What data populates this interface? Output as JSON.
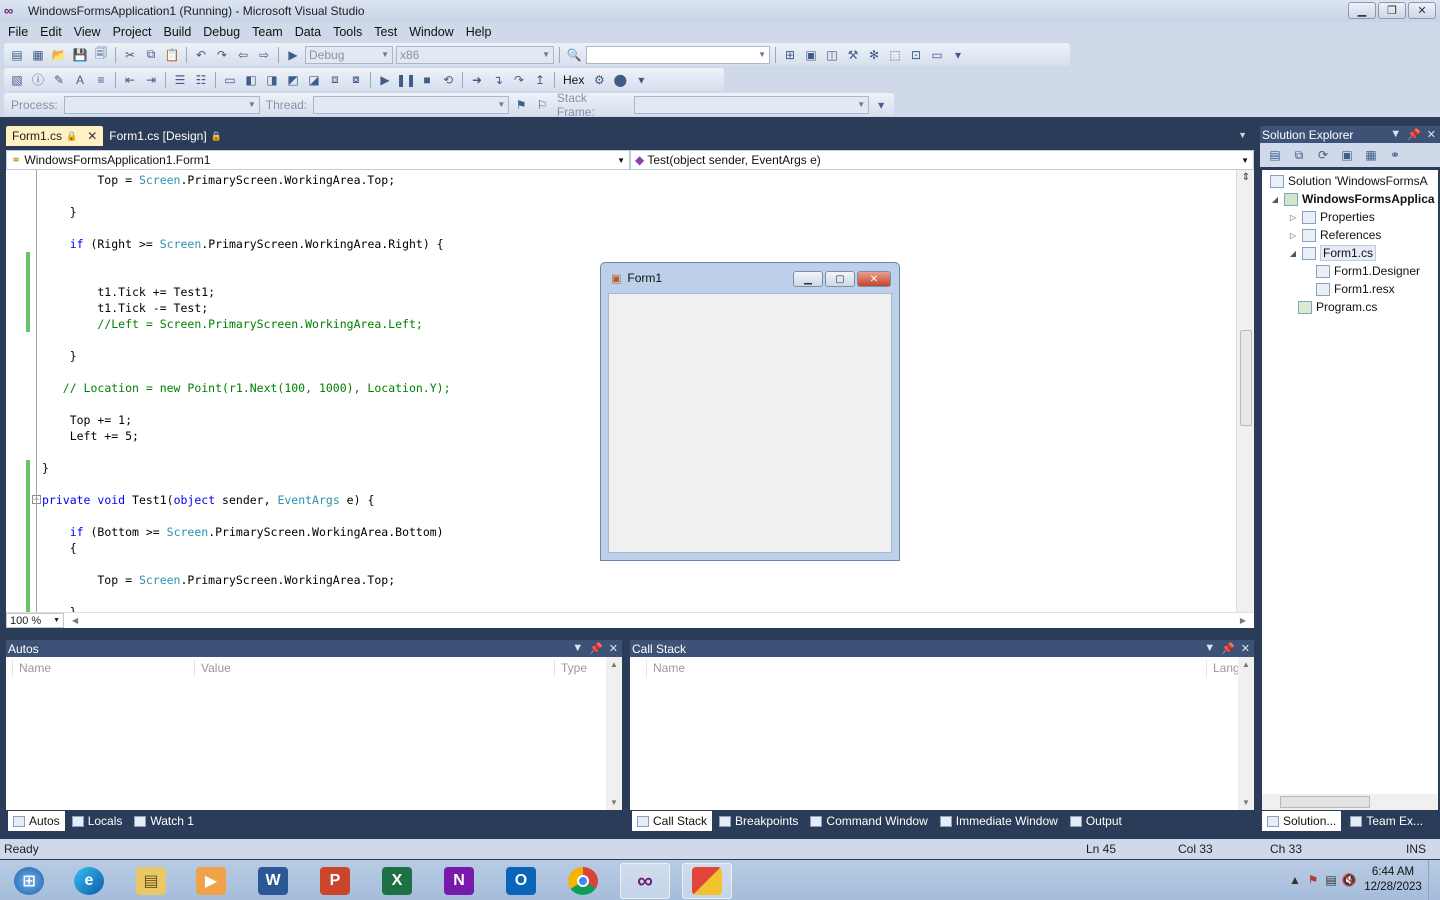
{
  "window": {
    "title": "WindowsFormsApplication1 (Running) - Microsoft Visual Studio"
  },
  "menu": [
    "File",
    "Edit",
    "View",
    "Project",
    "Build",
    "Debug",
    "Team",
    "Data",
    "Tools",
    "Test",
    "Window",
    "Help"
  ],
  "toolbar": {
    "config": "Debug",
    "platform": "x86",
    "hex_label": "Hex",
    "process_label": "Process:",
    "thread_label": "Thread:",
    "stack_frame_label": "Stack Frame:"
  },
  "tabs": [
    {
      "label": "Form1.cs",
      "active": true
    },
    {
      "label": "Form1.cs [Design]",
      "active": false
    }
  ],
  "nav": {
    "class": "WindowsFormsApplication1.Form1",
    "member": "Test(object sender, EventArgs e)"
  },
  "code": [
    "        Top = Screen.PrimaryScreen.WorkingArea.Top;",
    "",
    "    }",
    "",
    "    if (Right >= Screen.PrimaryScreen.WorkingArea.Right) {",
    "",
    "",
    "        t1.Tick += Test1;",
    "        t1.Tick -= Test;",
    "        //Left = Screen.PrimaryScreen.WorkingArea.Left;",
    "",
    "    }",
    "",
    "   // Location = new Point(r1.Next(100, 1000), Location.Y);",
    "",
    "    Top += 1;",
    "    Left += 5;",
    "",
    "}",
    "",
    "private void Test1(object sender, EventArgs e) {",
    "",
    "    if (Bottom >= Screen.PrimaryScreen.WorkingArea.Bottom)",
    "    {",
    "",
    "        Top = Screen.PrimaryScreen.WorkingArea.Top;",
    "",
    "    }"
  ],
  "editor": {
    "zoom": "100 %"
  },
  "solution_explorer": {
    "title": "Solution Explorer",
    "items": [
      {
        "label": "Solution 'WindowsFormsA",
        "indent": 0
      },
      {
        "label": "WindowsFormsApplica",
        "indent": 1
      },
      {
        "label": "Properties",
        "indent": 2
      },
      {
        "label": "References",
        "indent": 2
      },
      {
        "label": "Form1.cs",
        "indent": 2
      },
      {
        "label": "Form1.Designer",
        "indent": 3
      },
      {
        "label": "Form1.resx",
        "indent": 3
      },
      {
        "label": "Program.cs",
        "indent": 2
      }
    ],
    "tabs": [
      "Solution...",
      "Team Ex..."
    ]
  },
  "autos": {
    "title": "Autos",
    "columns": [
      "Name",
      "Value",
      "Type"
    ],
    "tabs": [
      "Autos",
      "Locals",
      "Watch 1"
    ]
  },
  "callstack": {
    "title": "Call Stack",
    "columns": [
      "Name",
      "Lang"
    ],
    "tabs": [
      "Call Stack",
      "Breakpoints",
      "Command Window",
      "Immediate Window",
      "Output"
    ]
  },
  "status": {
    "ready": "Ready",
    "ln": "Ln 45",
    "col": "Col 33",
    "ch": "Ch 33",
    "ins": "INS"
  },
  "form1": {
    "title": "Form1"
  },
  "taskbar": {
    "time": "6:44 AM",
    "date": "12/28/2023"
  },
  "colors": {
    "keyword": "#0000ff",
    "type": "#2b91af",
    "comment": "#008000",
    "ide_bg": "#2b3c59",
    "active_tab": "#fff1c4"
  }
}
